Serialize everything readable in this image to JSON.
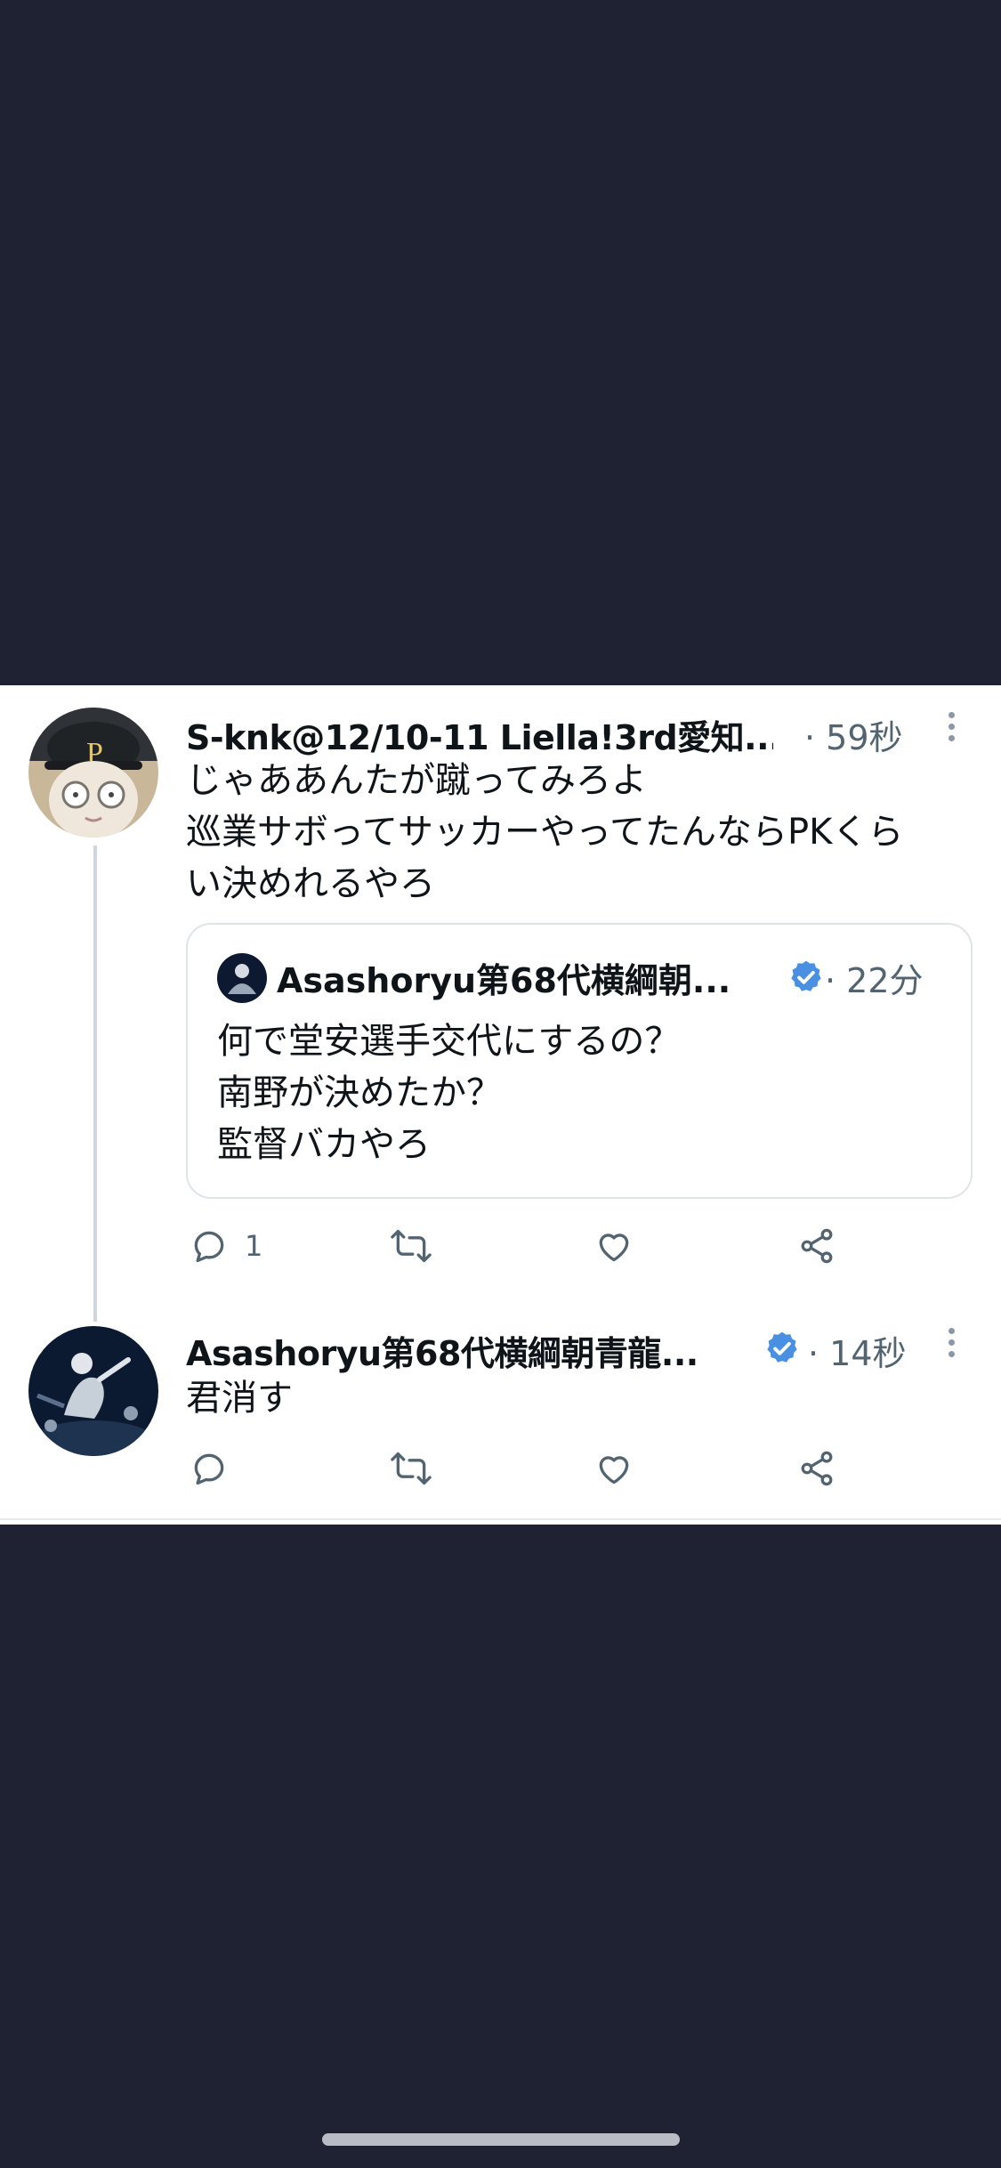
{
  "tweets": [
    {
      "author": "S-knk@12/10-11 Liella!3rd愛知...",
      "time": "59秒",
      "text_lines": [
        "じゃああんたが蹴ってみろよ",
        "巡業サボってサッカーやってたんならPKくら",
        "い決めれるやろ"
      ],
      "quote": {
        "author": "Asashoryu第68代横綱朝...",
        "time": "22分",
        "verified": true,
        "text_lines": [
          "何で堂安選手交代にするの？",
          "南野が決めたか？",
          "監督バカやろ"
        ]
      },
      "actions": {
        "reply_count": "1"
      }
    },
    {
      "author": "Asashoryu第68代横綱朝青龍...",
      "verified": true,
      "time": "14秒",
      "text_lines": [
        "君消す"
      ]
    }
  ],
  "icons": {
    "reply": "reply-icon",
    "retweet": "retweet-icon",
    "like": "heart-icon",
    "share": "share-icon",
    "more": "more-vertical-icon",
    "verified": "verified-badge-icon"
  },
  "colors": {
    "background": "#1e2232",
    "verified": "#4a90e2",
    "text": "#0f1419",
    "muted": "#536471"
  }
}
